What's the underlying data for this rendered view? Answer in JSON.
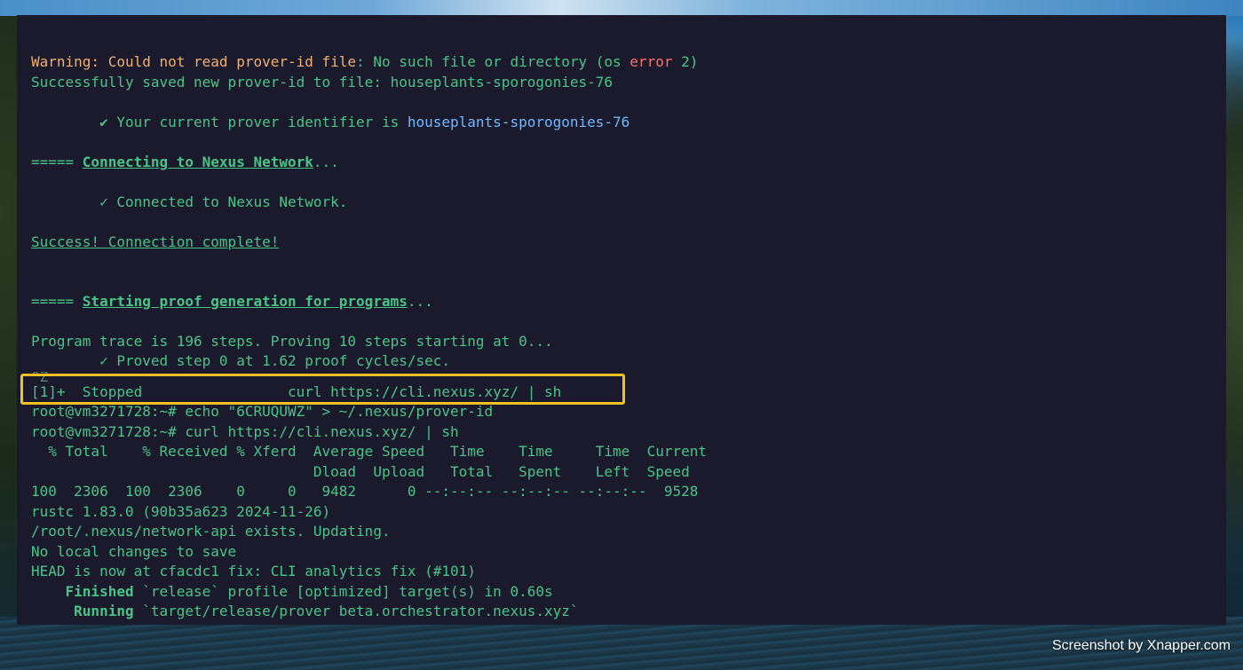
{
  "terminal": {
    "warning": {
      "label": "Warning:",
      "msg1": " Could not read prover-id file",
      "sep": ": No such file or directory (os ",
      "error_word": "error",
      "tail": " 2)"
    },
    "saved_line": "Successfully saved new prover-id to file: houseplants-sporogonies-76",
    "identifier": {
      "prefix": "        ✔ Your current prover identifier is ",
      "value": "houseplants-sporogonies-76"
    },
    "connecting": {
      "prefix": "===== ",
      "title": "Connecting to Nexus Network",
      "suffix": "..."
    },
    "connected_line": "        ✓ Connected to Nexus Network.",
    "success_line": "Success! Connection complete!",
    "starting": {
      "prefix": "===== ",
      "title": "Starting proof generation for programs",
      "suffix": "..."
    },
    "trace_line": "Program trace is 196 steps. Proving 10 steps starting at 0...",
    "proved_line": "        ✓ Proved step 0 at 1.62 proof cycles/sec.",
    "ctrl_z": "^Z",
    "stopped_line": "[1]+  Stopped                 curl https://cli.nexus.xyz/ | sh",
    "echo_cmd": "root@vm3271728:~# echo \"6CRUQUWZ\" > ~/.nexus/prover-id",
    "curl_cmd": "root@vm3271728:~# curl https://cli.nexus.xyz/ | sh",
    "curl_header1": "  % Total    % Received % Xferd  Average Speed   Time    Time     Time  Current",
    "curl_header2": "                                 Dload  Upload   Total   Spent    Left  Speed",
    "curl_progress": "100  2306  100  2306    0     0   9482      0 --:--:-- --:--:-- --:--:--  9528",
    "rustc_line": "rustc 1.83.0 (90b35a623 2024-11-26)",
    "exists_line": "/root/.nexus/network-api exists. Updating.",
    "nochanges_line": "No local changes to save",
    "head_line": "HEAD is now at cfacdc1 fix: CLI analytics fix (#101)",
    "finished": {
      "label": "    Finished",
      "rest": " `release` profile [optimized] target(s) in 0.60s"
    },
    "running": {
      "label": "     Running",
      "rest": " `target/release/prover beta.orchestrator.nexus.xyz`"
    }
  },
  "watermark": "Screenshot by Xnapper.com"
}
